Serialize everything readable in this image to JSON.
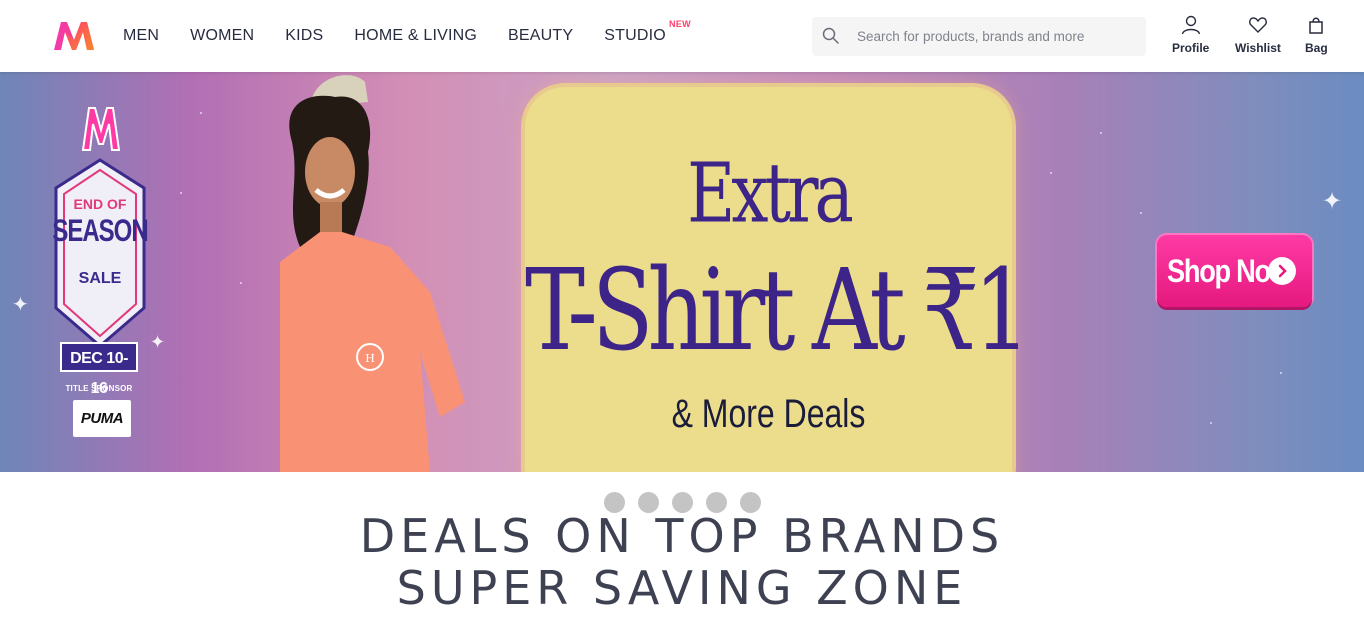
{
  "header": {
    "nav": [
      {
        "label": "MEN"
      },
      {
        "label": "WOMEN"
      },
      {
        "label": "KIDS"
      },
      {
        "label": "HOME & LIVING"
      },
      {
        "label": "BEAUTY"
      },
      {
        "label": "STUDIO",
        "badge": "NEW"
      }
    ],
    "search": {
      "placeholder": "Search for products, brands and more",
      "icon": "search-icon"
    },
    "actions": [
      {
        "label": "Profile",
        "icon": "profile-icon"
      },
      {
        "label": "Wishlist",
        "icon": "heart-icon"
      },
      {
        "label": "Bag",
        "icon": "bag-icon"
      }
    ]
  },
  "banner": {
    "sale": {
      "line1": "END OF",
      "line2": "SEASON",
      "line3": "SALE",
      "dates": "DEC 10-16",
      "sponsor_label": "TITLE SPONSOR",
      "sponsor": "PUMA"
    },
    "headline_top": "Extra",
    "headline_main": "T-Shirt At ₹1",
    "headline_sub": "& More Deals",
    "cta": "Shop Now",
    "slides_count": 5
  },
  "section": {
    "title_line1": "DEALS ON TOP BRANDS",
    "title_line2": "SUPER SAVING ZONE"
  },
  "colors": {
    "brand_pink": "#ff3f6c",
    "card_yellow": "#ecdd8c",
    "headline_purple": "#3c2488",
    "cta_pink": "#e5197f"
  }
}
